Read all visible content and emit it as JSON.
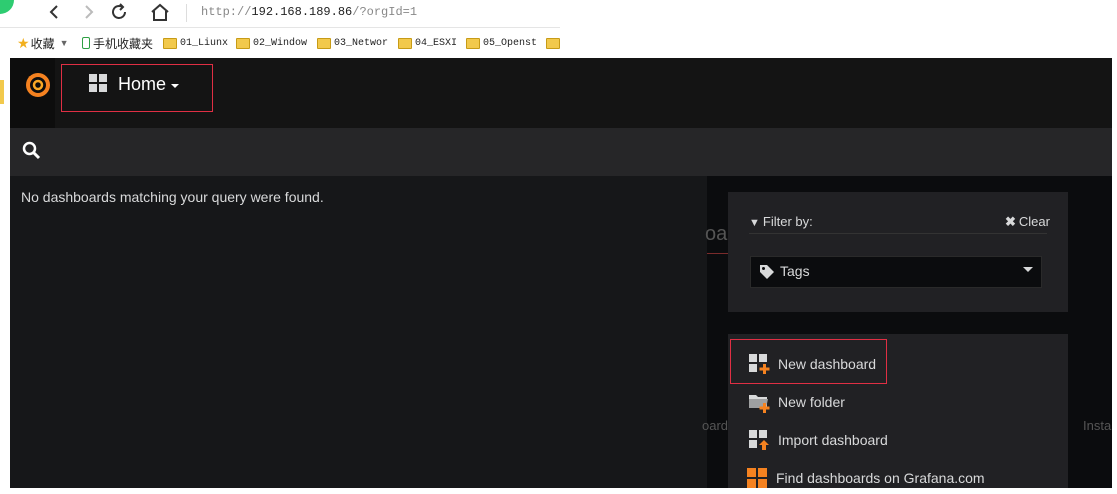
{
  "browser": {
    "url_prefix": "http://",
    "url_host": "192.168.189.86",
    "url_path": "/?orgId=1"
  },
  "bookmarks": {
    "favorites": "收藏",
    "mobile": "手机收藏夹",
    "folders": [
      "01_Liunx",
      "02_Window",
      "03_Networ",
      "04_ESXI",
      "05_Openst"
    ]
  },
  "nav": {
    "home_label": "Home"
  },
  "search": {
    "empty_message": "No dashboards matching your query were found."
  },
  "filter": {
    "label": "Filter by:",
    "clear_label": "Clear",
    "tags_label": "Tags"
  },
  "actions": {
    "new_dashboard": "New dashboard",
    "new_folder": "New folder",
    "import_dashboard": "Import dashboard",
    "find_dashboards": "Find dashboards on Grafana.com"
  },
  "background": {
    "ghost_text": "oar",
    "ghost_install": "Insta",
    "ghost_dash": "oard"
  },
  "colors": {
    "accent_orange": "#f58220",
    "highlight_red": "#e02f44",
    "panel_bg": "#212124"
  }
}
